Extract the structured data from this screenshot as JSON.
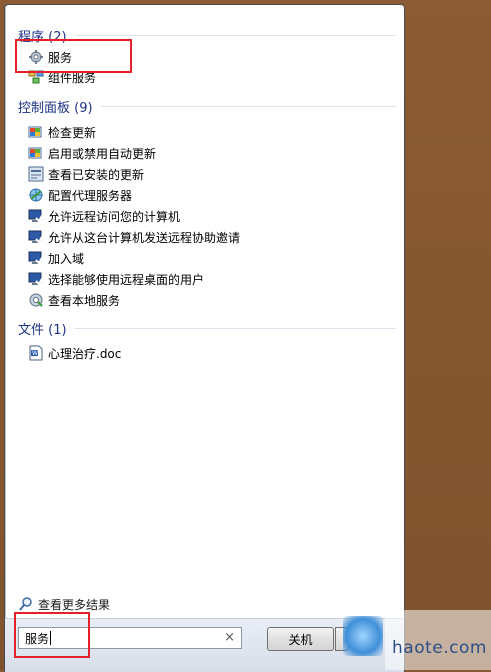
{
  "sections": [
    {
      "title": "程序 (2)",
      "items": [
        {
          "label": "服务",
          "icon": "services-gear-icon"
        },
        {
          "label": "组件服务",
          "icon": "component-services-icon"
        }
      ]
    },
    {
      "title": "控制面板 (9)",
      "items": [
        {
          "label": "检查更新",
          "icon": "windows-update-icon"
        },
        {
          "label": "启用或禁用自动更新",
          "icon": "windows-update-icon"
        },
        {
          "label": "查看已安装的更新",
          "icon": "programs-features-icon"
        },
        {
          "label": "配置代理服务器",
          "icon": "internet-options-icon"
        },
        {
          "label": "允许远程访问您的计算机",
          "icon": "system-icon"
        },
        {
          "label": "允许从这台计算机发送远程协助邀请",
          "icon": "system-icon"
        },
        {
          "label": "加入域",
          "icon": "system-icon"
        },
        {
          "label": "选择能够使用远程桌面的用户",
          "icon": "system-icon"
        },
        {
          "label": "查看本地服务",
          "icon": "admin-tools-icon"
        }
      ]
    },
    {
      "title": "文件 (1)",
      "items": [
        {
          "label": "心理治疗.doc",
          "icon": "word-document-icon"
        }
      ]
    }
  ],
  "see_more": "查看更多结果",
  "search": {
    "value": "服务",
    "clear": "×"
  },
  "shutdown": {
    "label": "关机"
  },
  "watermark": "haote.com",
  "colors": {
    "header": "#1e3287",
    "highlight": "#e5202a",
    "desktop": "#8a5a32"
  }
}
